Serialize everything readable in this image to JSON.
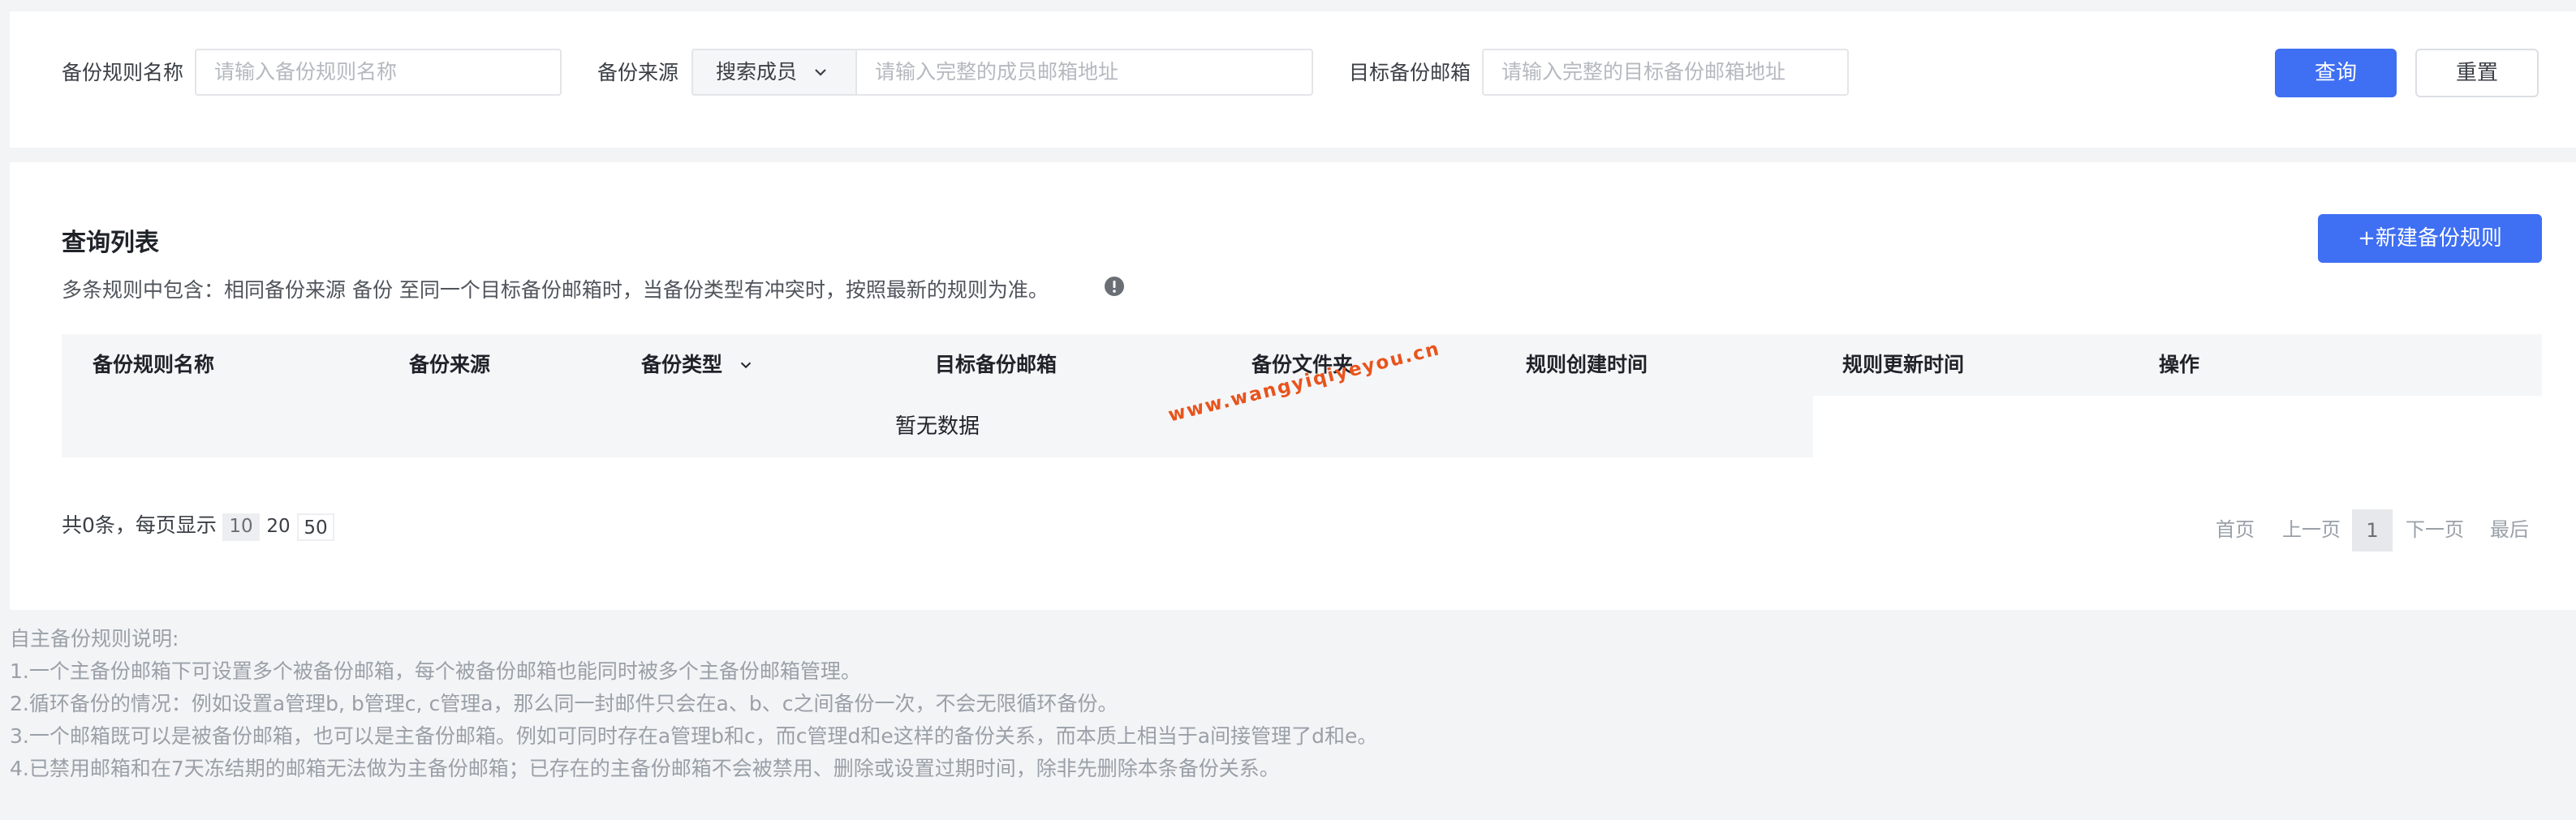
{
  "filters": {
    "rule_name_label": "备份规则名称",
    "rule_name_placeholder": "请输入备份规则名称",
    "source_label": "备份来源",
    "source_select_value": "搜索成员",
    "source_placeholder": "请输入完整的成员邮箱地址",
    "target_label": "目标备份邮箱",
    "target_placeholder": "请输入完整的目标备份邮箱地址",
    "query_button": "查询",
    "reset_button": "重置"
  },
  "list": {
    "title": "查询列表",
    "description": "多条规则中包含：相同备份来源 备份 至同一个目标备份邮箱时，当备份类型有冲突时，按照最新的规则为准。",
    "new_rule_button": "+新建备份规则",
    "columns": [
      "备份规则名称",
      "备份来源",
      "备份类型",
      "目标备份邮箱",
      "备份文件夹",
      "规则创建时间",
      "规则更新时间",
      "操作"
    ],
    "empty_text": "暂无数据",
    "watermark": "www.wangyiqiyeyou.cn"
  },
  "pagination": {
    "total_text": "共0条，每页显示",
    "page_sizes": [
      "10",
      "20",
      "50"
    ],
    "selected_page_size": "10",
    "first": "首页",
    "prev": "上一页",
    "current": "1",
    "next": "下一页",
    "last": "最后"
  },
  "notes": {
    "lines": [
      "自主备份规则说明:",
      "1.一个主备份邮箱下可设置多个被备份邮箱，每个被备份邮箱也能同时被多个主备份邮箱管理。",
      "2.循环备份的情况：例如设置a管理b, b管理c, c管理a，那么同一封邮件只会在a、b、c之间备份一次，不会无限循环备份。",
      "3.一个邮箱既可以是被备份邮箱，也可以是主备份邮箱。例如可同时存在a管理b和c，而c管理d和e这样的备份关系，而本质上相当于a间接管理了d和e。",
      "4.已禁用邮箱和在7天冻结期的邮箱无法做为主备份邮箱；已存在的主备份邮箱不会被禁用、删除或设置过期时间，除非先删除本条备份关系。"
    ]
  },
  "colors": {
    "primary": "#3f6ff2",
    "watermark": "#e8541c"
  }
}
